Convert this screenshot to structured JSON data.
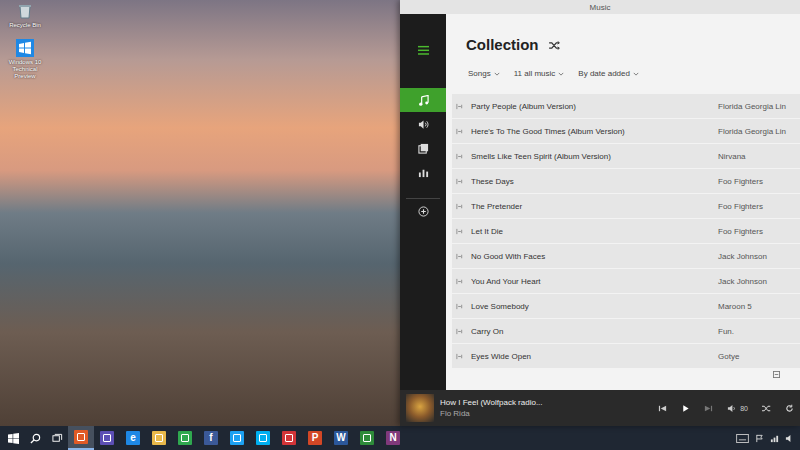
{
  "desktop": {
    "icons": [
      {
        "label": "Recycle Bin"
      },
      {
        "label": "Windows 10 Technical Preview"
      }
    ]
  },
  "window": {
    "title": "Music"
  },
  "nav": {
    "items": [
      {
        "selected": true
      },
      {
        "selected": false
      },
      {
        "selected": false
      },
      {
        "selected": false
      },
      {
        "selected": false
      }
    ]
  },
  "collection": {
    "title": "Collection",
    "filters": [
      {
        "label": "Songs"
      },
      {
        "label": "11 all music"
      },
      {
        "label": "By date added"
      }
    ]
  },
  "songs": [
    {
      "title": "Party People (Album Version)",
      "artist": "Florida Georgia Lin"
    },
    {
      "title": "Here's To The Good Times (Album Version)",
      "artist": "Florida Georgia Lin"
    },
    {
      "title": "Smells Like Teen Spirit (Album Version)",
      "artist": "Nirvana"
    },
    {
      "title": "These Days",
      "artist": "Foo Fighters"
    },
    {
      "title": "The Pretender",
      "artist": "Foo Fighters"
    },
    {
      "title": "Let It Die",
      "artist": "Foo Fighters"
    },
    {
      "title": "No Good With Faces",
      "artist": "Jack Johnson"
    },
    {
      "title": "You And Your Heart",
      "artist": "Jack Johnson"
    },
    {
      "title": "Love Somebody",
      "artist": "Maroon 5"
    },
    {
      "title": "Carry On",
      "artist": "Fun."
    },
    {
      "title": "Eyes Wide Open",
      "artist": "Gotye"
    }
  ],
  "now_playing": {
    "title": "How I Feel (Wolfpack radio...",
    "artist": "Flo Rida",
    "volume": "80"
  },
  "taskbar": {
    "apps": [
      {
        "color": "#e05a26",
        "selected": true
      },
      {
        "color": "#5c4fb5",
        "selected": false
      },
      {
        "color": "#1e88e5",
        "selected": false,
        "glyph": "e"
      },
      {
        "color": "#e8b84a",
        "selected": false
      },
      {
        "color": "#2fa84f",
        "selected": false
      },
      {
        "color": "#3b5998",
        "selected": false,
        "glyph": "f"
      },
      {
        "color": "#1da1f2",
        "selected": false
      },
      {
        "color": "#00aff0",
        "selected": false
      },
      {
        "color": "#d13438",
        "selected": false
      },
      {
        "color": "#d24726",
        "selected": false,
        "glyph": "P"
      },
      {
        "color": "#2b579a",
        "selected": false,
        "glyph": "W"
      },
      {
        "color": "#2e8b3a",
        "selected": false
      },
      {
        "color": "#80397b",
        "selected": false,
        "glyph": "N"
      }
    ]
  }
}
